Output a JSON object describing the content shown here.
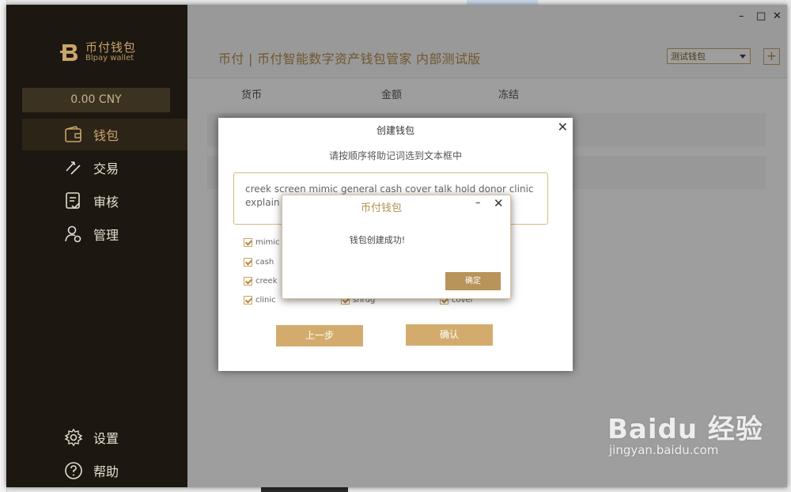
{
  "app": {
    "logo_cn": "币付钱包",
    "logo_en": "Blpay wallet",
    "balance": "0.00 CNY",
    "colors": {
      "sidebar_bg": "#1c1710",
      "accent": "#c9a46c",
      "button": "#d3ac6d"
    }
  },
  "sidebar": {
    "items": [
      {
        "label": "钱包",
        "icon": "wallet-icon",
        "active": true
      },
      {
        "label": "交易",
        "icon": "transfer-icon"
      },
      {
        "label": "审核",
        "icon": "audit-icon"
      },
      {
        "label": "管理",
        "icon": "user-settings-icon"
      }
    ],
    "bottom": [
      {
        "label": "设置",
        "icon": "gear-icon"
      },
      {
        "label": "帮助",
        "icon": "help-icon"
      }
    ]
  },
  "window": {
    "minimize": "–",
    "maximize": "□",
    "close": "✕"
  },
  "header": {
    "title": "币付 | 币付智能数字资产钱包管家 内部测试版",
    "wallet_select": "测试钱包",
    "add_button": "+"
  },
  "table": {
    "columns": [
      "货币",
      "金额",
      "冻结"
    ]
  },
  "create_dialog": {
    "title": "创建钱包",
    "close": "✕",
    "instruction": "请按顺序将助记词选到文本框中",
    "phrase": "creek screen mimic general cash cover talk hold donor clinic explain s",
    "checkboxes_left": [
      "mimic",
      "cash",
      "creek",
      "clinic"
    ],
    "checkboxes_extra": [
      "shrug",
      "cover"
    ],
    "prev_button": "上一步",
    "confirm_button": "确认"
  },
  "success_popup": {
    "title": "币付钱包",
    "minimize": "–",
    "close": "✕",
    "message": "钱包创建成功!",
    "ok_button": "确定"
  },
  "watermark": {
    "main": "Baidu 经验",
    "sub": "jingyan.baidu.com"
  }
}
